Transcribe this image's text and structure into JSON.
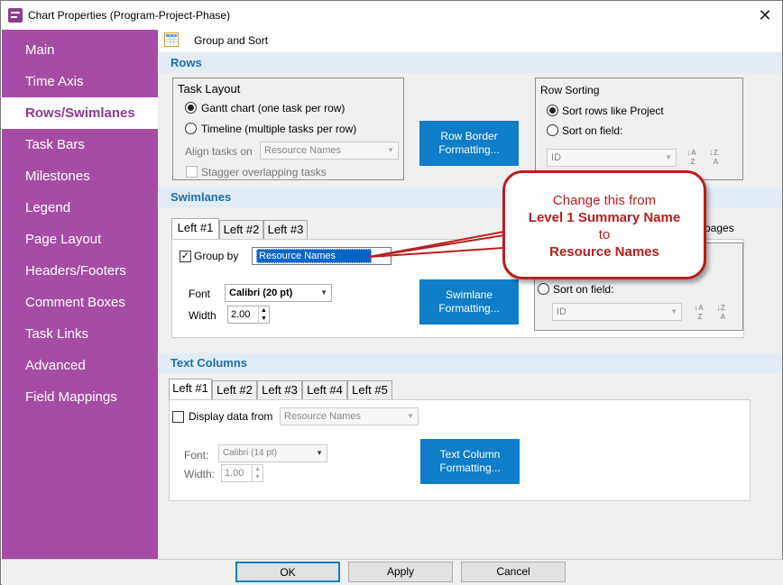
{
  "window": {
    "title": "Chart Properties (Program-Project-Phase)",
    "close": "✕"
  },
  "sidebar": {
    "items": [
      {
        "label": "Main"
      },
      {
        "label": "Time Axis"
      },
      {
        "label": "Rows/Swimlanes",
        "active": true
      },
      {
        "label": "Task Bars"
      },
      {
        "label": "Milestones"
      },
      {
        "label": "Legend"
      },
      {
        "label": "Page Layout"
      },
      {
        "label": "Headers/Footers"
      },
      {
        "label": "Comment Boxes"
      },
      {
        "label": "Task Links"
      },
      {
        "label": "Advanced"
      },
      {
        "label": "Field Mappings"
      }
    ]
  },
  "toolbar": {
    "group_sort_label": "Group and Sort"
  },
  "rows": {
    "section_title": "Rows",
    "task_layout": {
      "title": "Task Layout",
      "gantt_label": "Gantt chart (one task per row)",
      "timeline_label": "Timeline (multiple tasks per row)",
      "align_label": "Align tasks on",
      "align_value": "Resource Names",
      "stagger_label": "Stagger overlapping tasks"
    },
    "border_button": "Row Border Formatting...",
    "sorting": {
      "title": "Row Sorting",
      "like_project_label": "Sort rows like Project",
      "on_field_label": "Sort on field:",
      "field_value": "ID",
      "asc_icon": "sort-ascending-icon",
      "desc_icon": "sort-descending-icon"
    }
  },
  "swimlanes": {
    "section_title": "Swimlanes",
    "tabs": [
      "Left #1",
      "Left #2",
      "Left #3"
    ],
    "group_by_label": "Group by",
    "group_by_value": "Resource Names",
    "font_label": "Font",
    "font_value": "Calibri (20 pt)",
    "width_label": "Width",
    "width_value": "2.00",
    "formatting_button": "Swimlane Formatting...",
    "pages_label": "pages",
    "sort_on_field_label": "Sort on field:",
    "sort_field_value": "ID"
  },
  "text_columns": {
    "section_title": "Text Columns",
    "tabs": [
      "Left #1",
      "Left #2",
      "Left #3",
      "Left #4",
      "Left #5"
    ],
    "display_label": "Display data from",
    "display_value": "Resource Names",
    "font_label": "Font:",
    "font_value": "Calibri (14 pt)",
    "width_label": "Width:",
    "width_value": "1.00",
    "formatting_button": "Text Column Formatting..."
  },
  "callout": {
    "line1": "Change this from",
    "line2": "Level 1 Summary Name",
    "line3": "to",
    "line4": "Resource Names",
    "color": "#b81e1e"
  },
  "footer": {
    "ok": "OK",
    "apply": "Apply",
    "cancel": "Cancel"
  },
  "colors": {
    "sidebar": "#a64ca6",
    "accent_button": "#0f7dc8",
    "section_text": "#1f6fa7"
  }
}
